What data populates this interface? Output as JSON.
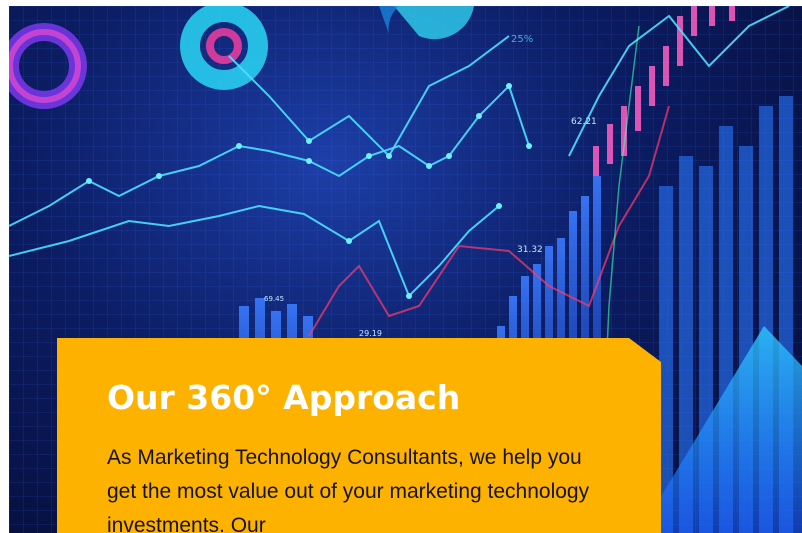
{
  "hero": {
    "image_description_icon": "financial-chart-background",
    "chart_readouts": [
      "25%",
      "62.21",
      "31.32",
      "29.19",
      "69.45"
    ]
  },
  "card": {
    "title": "Our 360° Approach",
    "body": "As Marketing Technology Consultants, we help you get the most value out of your marketing technology investments. Our",
    "background_color": "#feb200"
  }
}
